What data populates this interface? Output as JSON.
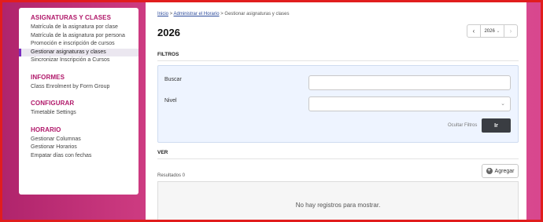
{
  "sidebar": {
    "sections": [
      {
        "title": "ASIGNATURAS Y CLASES",
        "items": [
          {
            "label": "Matrícula de la asignatura por clase"
          },
          {
            "label": "Matrícula de la asignatura por persona"
          },
          {
            "label": "Promoción e inscripción de cursos"
          },
          {
            "label": "Gestionar asignaturas y clases",
            "active": true
          },
          {
            "label": "Sincronizar Inscripción a Cursos"
          }
        ]
      },
      {
        "title": "INFORMES",
        "items": [
          {
            "label": "Class Enrolment by Form Group"
          }
        ]
      },
      {
        "title": "CONFIGURAR",
        "items": [
          {
            "label": "Timetable Settings"
          }
        ]
      },
      {
        "title": "HORARIO",
        "items": [
          {
            "label": "Gestionar Columnas"
          },
          {
            "label": "Gestionar Horarios"
          },
          {
            "label": "Empatar días con fechas"
          }
        ]
      }
    ]
  },
  "breadcrumb": {
    "home": "Inicio",
    "sep1": " > ",
    "parent": "Administrar el Horario",
    "sep2": " > ",
    "current": "Gestionar asignaturas y clases"
  },
  "page": {
    "title": "2026",
    "year_select": "2026",
    "prev_icon": "‹",
    "next_icon": "›",
    "chevron": "⌄"
  },
  "filters": {
    "heading": "FILTROS",
    "search_label": "Buscar",
    "search_value": "",
    "level_label": "Nivel",
    "level_value": "",
    "hide_label": "Ocultar Filtros",
    "go_label": "Ir"
  },
  "view": {
    "heading": "VER",
    "results": "Resultados 0",
    "add_label": "Agregar",
    "empty_message": "No hay registros para mostrar."
  },
  "colors": {
    "accent": "#b01769",
    "frame": "#e11d1d",
    "active_marker": "#7b2cbf",
    "go_button": "#3a3d42"
  }
}
